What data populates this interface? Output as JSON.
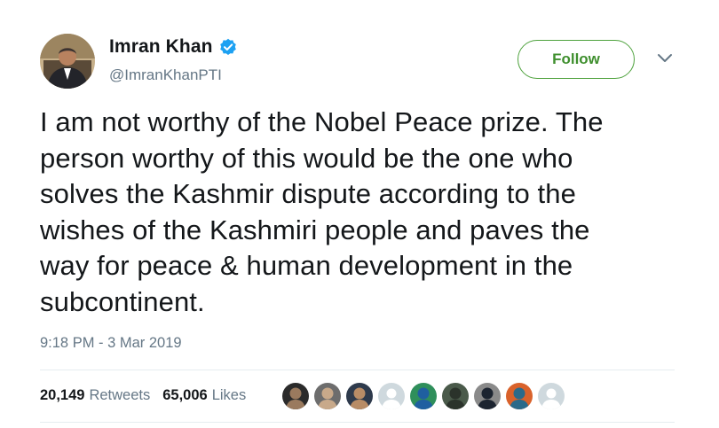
{
  "user": {
    "display_name": "Imran Khan",
    "handle": "@ImranKhanPTI",
    "verified": true,
    "avatar_icon": "profile-photo-icon"
  },
  "actions": {
    "follow_label": "Follow",
    "menu_icon": "chevron-down-icon"
  },
  "tweet": {
    "lines": [
      "I am not worthy of the Nobel Peace prize. The",
      "person worthy of this would be the one who",
      "solves the Kashmir dispute according to the",
      "wishes of the Kashmiri people and paves the",
      "way for peace & human development in the",
      "subcontinent."
    ],
    "timestamp": "9:18 PM - 3 Mar 2019"
  },
  "stats": {
    "retweets_count": "20,149",
    "retweets_label": "Retweets",
    "likes_count": "65,006",
    "likes_label": "Likes"
  },
  "likers": [
    {
      "kind": "photo",
      "bg": "#2b2b2b",
      "fg": "#9a7a5e"
    },
    {
      "kind": "photo",
      "bg": "#6d6d6d",
      "fg": "#c8a98a"
    },
    {
      "kind": "photo",
      "bg": "#2e3a4c",
      "fg": "#b88c66"
    },
    {
      "kind": "default",
      "bg": "#cfd9de",
      "fg": "#8899a6"
    },
    {
      "kind": "photo",
      "bg": "#2f8f5b",
      "fg": "#1f5fa0"
    },
    {
      "kind": "photo",
      "bg": "#4a5a4a",
      "fg": "#2b332b"
    },
    {
      "kind": "photo",
      "bg": "#8a8a8a",
      "fg": "#1c2430"
    },
    {
      "kind": "photo",
      "bg": "#d9622b",
      "fg": "#2a6a8a"
    },
    {
      "kind": "default",
      "bg": "#cfd9de",
      "fg": "#8899a6"
    }
  ],
  "colors": {
    "follow_green": "#3f8f2e",
    "verified_blue": "#1da1f2",
    "secondary_text": "#657786"
  }
}
